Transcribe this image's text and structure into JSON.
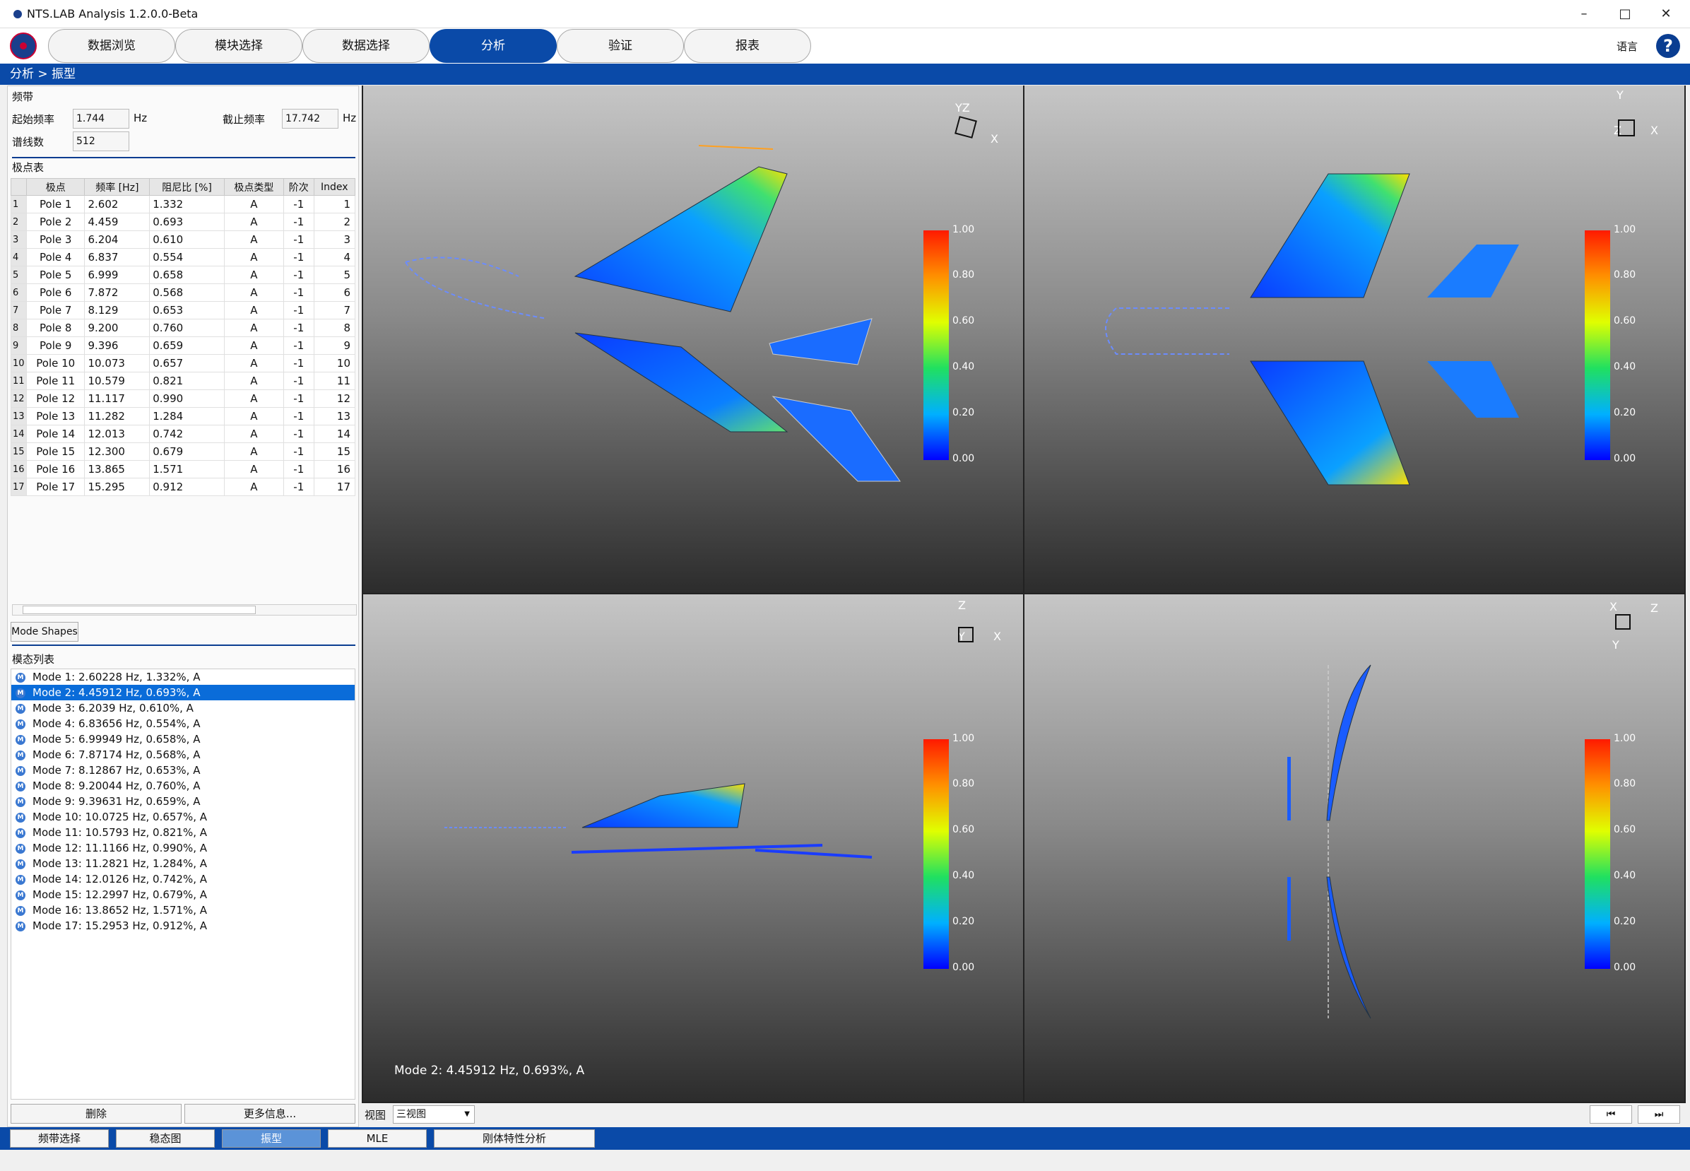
{
  "window": {
    "title": "NTS.LAB Analysis 1.2.0.0-Beta"
  },
  "toolbar": {
    "tabs": [
      "数据浏览",
      "模块选择",
      "数据选择",
      "分析",
      "验证",
      "报表"
    ],
    "active_tab": "分析",
    "language_label": "语言",
    "help_icon": "?"
  },
  "breadcrumb": "分析 > 振型",
  "band": {
    "section_title": "频带",
    "start_freq_label": "起始频率",
    "start_freq_value": "1.744",
    "start_unit": "Hz",
    "stop_freq_label": "截止频率",
    "stop_freq_value": "17.742",
    "stop_unit": "Hz",
    "lines_label": "谱线数",
    "lines_value": "512"
  },
  "poles": {
    "section_title": "极点表",
    "columns": [
      "极点",
      "频率 [Hz]",
      "阻尼比 [%]",
      "极点类型",
      "阶次",
      "Index"
    ],
    "rows": [
      [
        "1",
        "Pole 1",
        "2.602",
        "1.332",
        "A",
        "-1",
        "1"
      ],
      [
        "2",
        "Pole 2",
        "4.459",
        "0.693",
        "A",
        "-1",
        "2"
      ],
      [
        "3",
        "Pole 3",
        "6.204",
        "0.610",
        "A",
        "-1",
        "3"
      ],
      [
        "4",
        "Pole 4",
        "6.837",
        "0.554",
        "A",
        "-1",
        "4"
      ],
      [
        "5",
        "Pole 5",
        "6.999",
        "0.658",
        "A",
        "-1",
        "5"
      ],
      [
        "6",
        "Pole 6",
        "7.872",
        "0.568",
        "A",
        "-1",
        "6"
      ],
      [
        "7",
        "Pole 7",
        "8.129",
        "0.653",
        "A",
        "-1",
        "7"
      ],
      [
        "8",
        "Pole 8",
        "9.200",
        "0.760",
        "A",
        "-1",
        "8"
      ],
      [
        "9",
        "Pole 9",
        "9.396",
        "0.659",
        "A",
        "-1",
        "9"
      ],
      [
        "10",
        "Pole 10",
        "10.073",
        "0.657",
        "A",
        "-1",
        "10"
      ],
      [
        "11",
        "Pole 11",
        "10.579",
        "0.821",
        "A",
        "-1",
        "11"
      ],
      [
        "12",
        "Pole 12",
        "11.117",
        "0.990",
        "A",
        "-1",
        "12"
      ],
      [
        "13",
        "Pole 13",
        "11.282",
        "1.284",
        "A",
        "-1",
        "13"
      ],
      [
        "14",
        "Pole 14",
        "12.013",
        "0.742",
        "A",
        "-1",
        "14"
      ],
      [
        "15",
        "Pole 15",
        "12.300",
        "0.679",
        "A",
        "-1",
        "15"
      ],
      [
        "16",
        "Pole 16",
        "13.865",
        "1.571",
        "A",
        "-1",
        "16"
      ],
      [
        "17",
        "Pole 17",
        "15.295",
        "0.912",
        "A",
        "-1",
        "17"
      ]
    ]
  },
  "mode_shapes_button": "Mode Shapes",
  "mode_list": {
    "section_title": "模态列表",
    "selected_index": 1,
    "items": [
      "Mode 1: 2.60228 Hz, 1.332%, A",
      "Mode 2: 4.45912 Hz, 0.693%, A",
      "Mode 3: 6.2039 Hz, 0.610%, A",
      "Mode 4: 6.83656 Hz, 0.554%, A",
      "Mode 5: 6.99949 Hz, 0.658%, A",
      "Mode 6: 7.87174 Hz, 0.568%, A",
      "Mode 7: 8.12867 Hz, 0.653%, A",
      "Mode 8: 9.20044 Hz, 0.760%, A",
      "Mode 9: 9.39631 Hz, 0.659%, A",
      "Mode 10: 10.0725 Hz, 0.657%, A",
      "Mode 11: 10.5793 Hz, 0.821%, A",
      "Mode 12: 11.1166 Hz, 0.990%, A",
      "Mode 13: 11.2821 Hz, 1.284%, A",
      "Mode 14: 12.0126 Hz, 0.742%, A",
      "Mode 15: 12.2997 Hz, 0.679%, A",
      "Mode 16: 13.8652 Hz, 1.571%, A",
      "Mode 17: 15.2953 Hz, 0.912%, A"
    ]
  },
  "list_buttons": {
    "delete": "删除",
    "more_info": "更多信息..."
  },
  "viewports": {
    "colorbar_ticks": [
      "1.00",
      "0.80",
      "0.60",
      "0.40",
      "0.20",
      "0.00"
    ],
    "axes": {
      "iso": [
        "YZ",
        "X"
      ],
      "top": [
        "Y",
        "X",
        "Z"
      ],
      "front": [
        "Z",
        "X",
        "Y"
      ],
      "side": [
        "X",
        "Z",
        "Y"
      ]
    },
    "caption": "Mode 2: 4.45912 Hz, 0.693%, A",
    "colors": {
      "high": "#d7191c",
      "mid": "#ffff00",
      "low": "#0000ff",
      "accent": "#0a4aa8"
    }
  },
  "viewbar": {
    "view_label": "视图",
    "view_value": "三视图",
    "prev_icon": "skip-back-icon",
    "next_icon": "skip-forward-icon"
  },
  "bottom_tabs": {
    "items": [
      "频带选择",
      "稳态图",
      "振型",
      "MLE",
      "刚体特性分析"
    ],
    "active": "振型"
  }
}
